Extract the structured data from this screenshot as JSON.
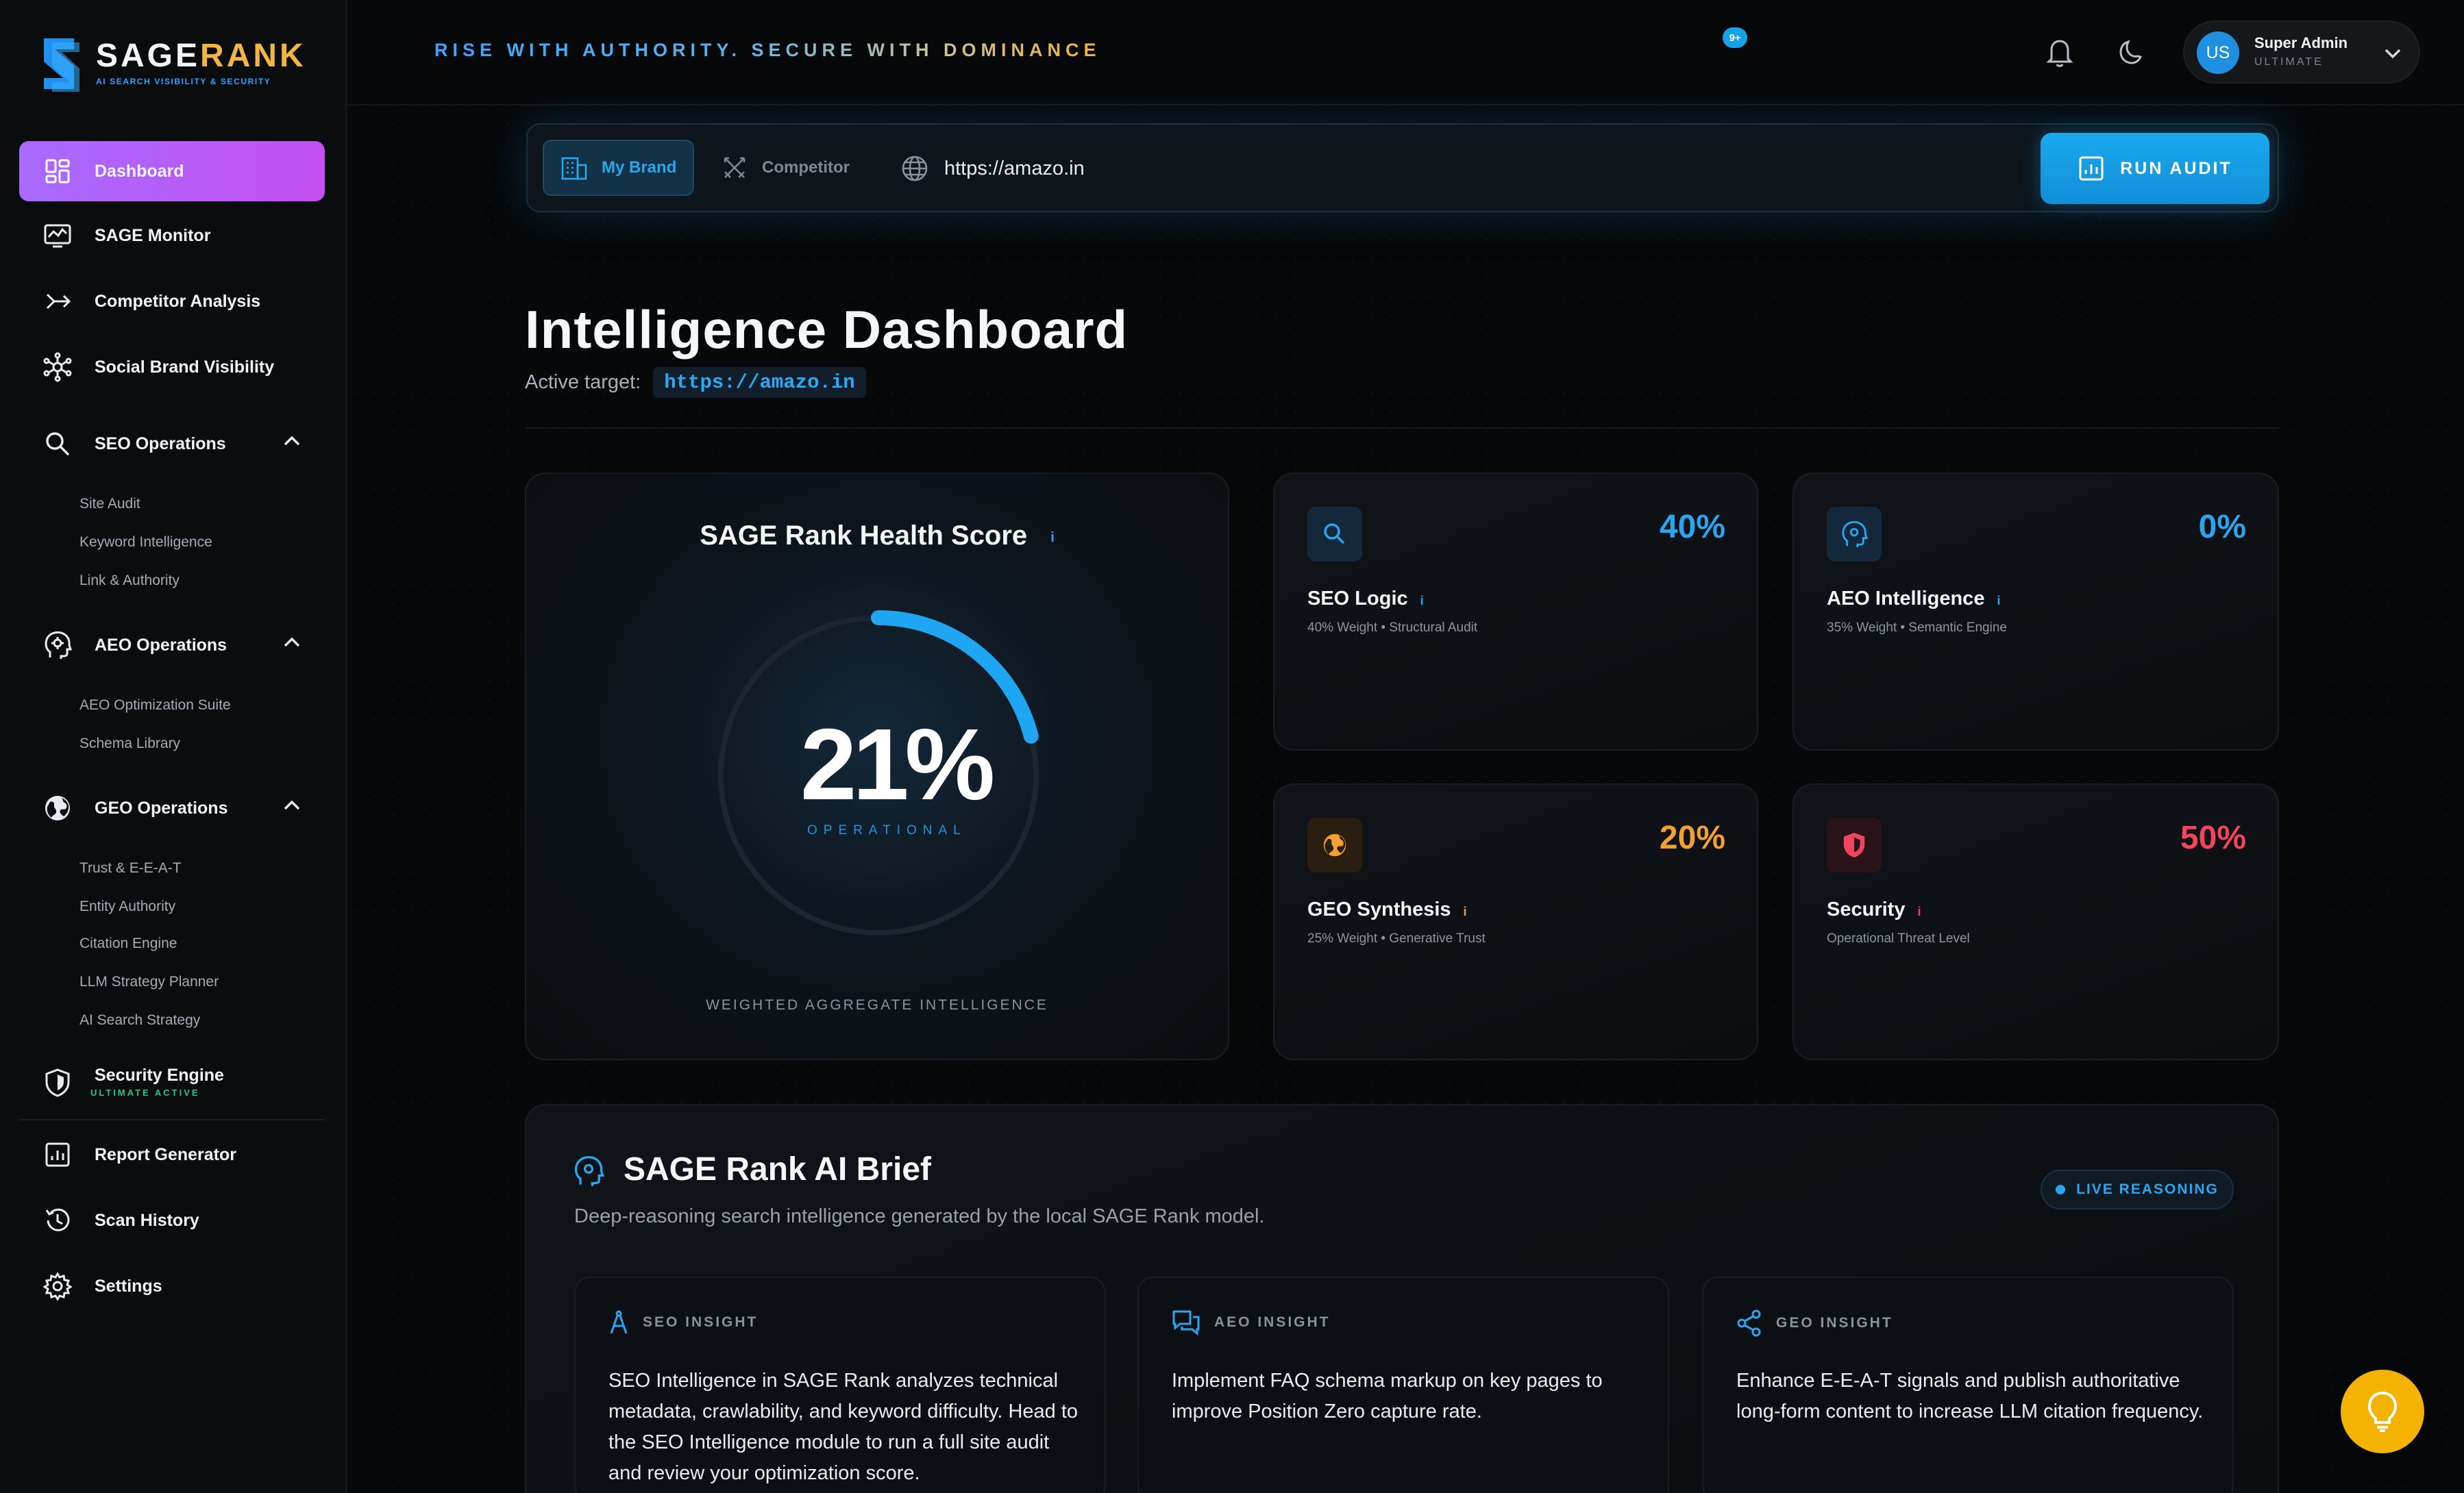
{
  "brand": {
    "name_prefix": "SAGE",
    "name_suffix": "RANK",
    "tagline_small": "AI SEARCH VISIBILITY & SECURITY"
  },
  "sidebar": {
    "items": [
      {
        "label": "Dashboard",
        "icon": "dashboard-icon"
      },
      {
        "label": "SAGE Monitor",
        "icon": "monitor-icon"
      },
      {
        "label": "Competitor Analysis",
        "icon": "compare-icon"
      },
      {
        "label": "Social Brand Visibility",
        "icon": "network-icon"
      }
    ],
    "groups": [
      {
        "label": "SEO Operations",
        "icon": "search-icon",
        "children": [
          "Site Audit",
          "Keyword Intelligence",
          "Link & Authority"
        ]
      },
      {
        "label": "AEO Operations",
        "icon": "ai-head-icon",
        "children": [
          "AEO Optimization Suite",
          "Schema Library"
        ]
      },
      {
        "label": "GEO Operations",
        "icon": "globe-icon",
        "children": [
          "Trust & E-E-A-T",
          "Entity Authority",
          "Citation Engine",
          "LLM Strategy Planner",
          "AI Search Strategy"
        ]
      }
    ],
    "security": {
      "label": "Security Engine",
      "sublabel": "ULTIMATE ACTIVE"
    },
    "bottom": [
      {
        "label": "Report Generator"
      },
      {
        "label": "Scan History"
      },
      {
        "label": "Settings"
      }
    ]
  },
  "header": {
    "tagline": "RISE WITH AUTHORITY. SECURE WITH DOMINANCE",
    "notifications_badge": "9+",
    "user": {
      "initials": "US",
      "name": "Super Admin",
      "role": "ULTIMATE"
    }
  },
  "audit_bar": {
    "tab_brand": "My Brand",
    "tab_competitor": "Competitor",
    "url_value": "https://amazo.in",
    "run_label": "RUN AUDIT"
  },
  "page": {
    "title": "Intelligence Dashboard",
    "active_target_label": "Active target:",
    "active_target_value": "https://amazo.in"
  },
  "health": {
    "title": "SAGE Rank Health Score",
    "info": "i",
    "score_text": "21%",
    "score_value": 21,
    "status": "OPERATIONAL",
    "footer": "WEIGHTED AGGREGATE INTELLIGENCE"
  },
  "metrics": [
    {
      "name": "SEO Logic",
      "pct": "40%",
      "desc": "40% Weight • Structural Audit",
      "color": "#2aa6f0",
      "icon": "search-icon"
    },
    {
      "name": "AEO Intelligence",
      "pct": "0%",
      "desc": "35% Weight • Semantic Engine",
      "color": "#2aa6f0",
      "icon": "ai-head-icon"
    },
    {
      "name": "GEO Synthesis",
      "pct": "20%",
      "desc": "25% Weight • Generative Trust",
      "color": "#f2a032",
      "icon": "globe-icon"
    },
    {
      "name": "Security",
      "pct": "50%",
      "desc": "Operational Threat Level",
      "color": "#f0455a",
      "icon": "shield-icon"
    }
  ],
  "brief": {
    "title": "SAGE Rank AI Brief",
    "subtitle": "Deep-reasoning search intelligence generated by the local SAGE Rank model.",
    "live_label": "LIVE REASONING",
    "insights": [
      {
        "title": "SEO INSIGHT",
        "body": "SEO Intelligence in SAGE Rank analyzes technical metadata, crawlability, and keyword difficulty. Head to the SEO Intelligence module to run a full site audit and review your optimization score."
      },
      {
        "title": "AEO INSIGHT",
        "body": "Implement FAQ schema markup on key pages to improve Position Zero capture rate."
      },
      {
        "title": "GEO INSIGHT",
        "body": "Enhance E-E-A-T signals and publish authoritative long-form content to increase LLM citation frequency."
      }
    ]
  },
  "colors": {
    "accent": "#1aa8ee",
    "active_nav": "#b45cf5",
    "gold": "#f2b544",
    "danger": "#f0455a",
    "warning": "#f2a032"
  }
}
